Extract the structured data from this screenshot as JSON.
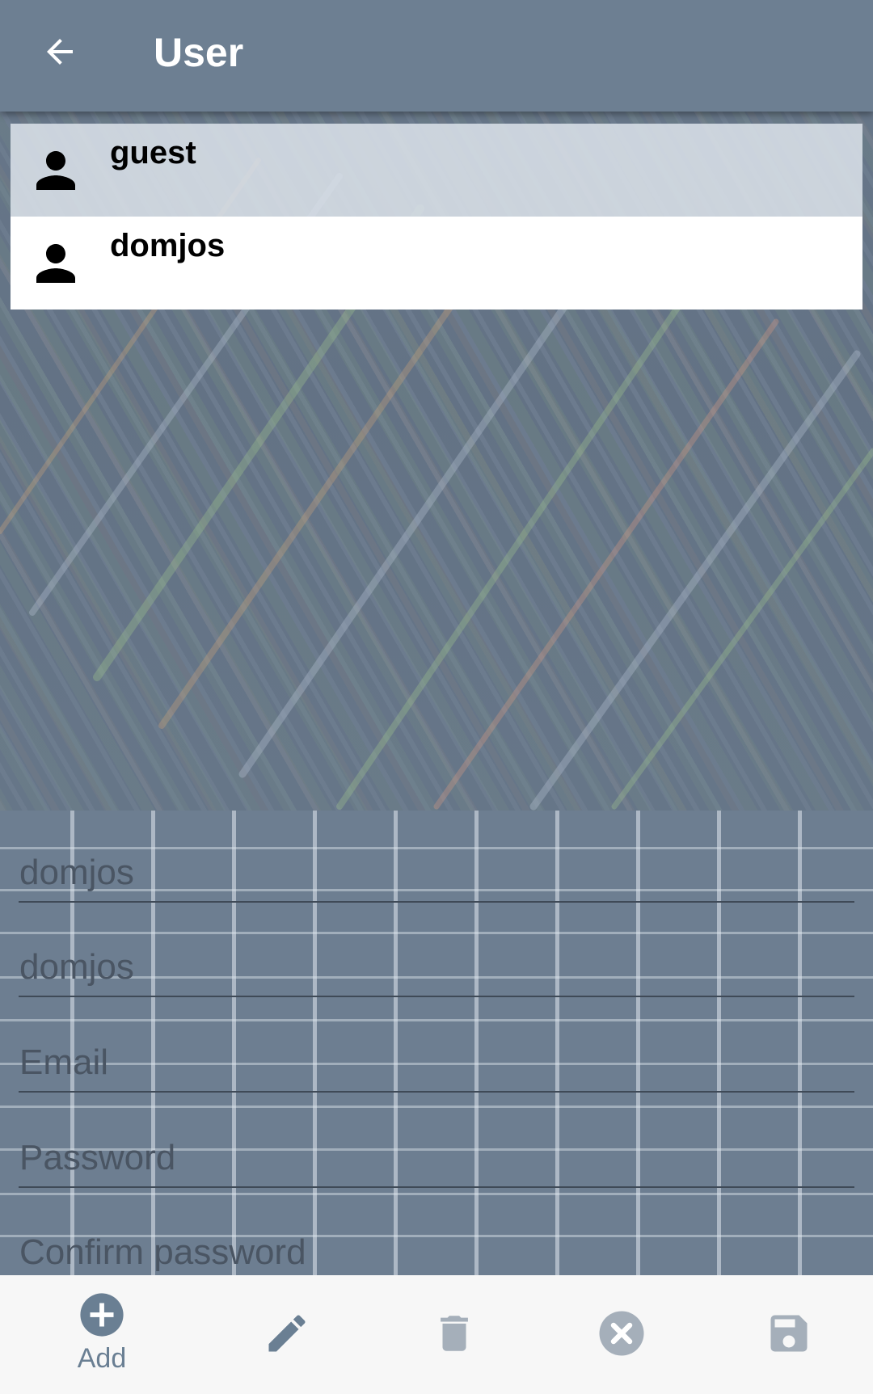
{
  "appbar": {
    "title": "User",
    "back_icon": "arrow-back-icon"
  },
  "users": [
    {
      "name": "guest",
      "icon": "person-icon",
      "selected": true
    },
    {
      "name": "domjos",
      "icon": "person-icon",
      "selected": false
    }
  ],
  "form": {
    "username_value": "domjos",
    "fullname_value": "domjos",
    "email_placeholder": "Email",
    "password_placeholder": "Password",
    "confirm_password_placeholder": "Confirm password"
  },
  "toolbar": {
    "add_label": "Add",
    "add_icon": "add-circle-icon",
    "edit_icon": "pencil-icon",
    "delete_icon": "trash-icon",
    "cancel_icon": "cancel-circle-icon",
    "save_icon": "floppy-disk-icon"
  },
  "colors": {
    "appbar": "#6d7f92",
    "toolbar_bg": "#f7f7f7",
    "accent": "#6a7f93",
    "disabled_icon": "#a5afba"
  }
}
